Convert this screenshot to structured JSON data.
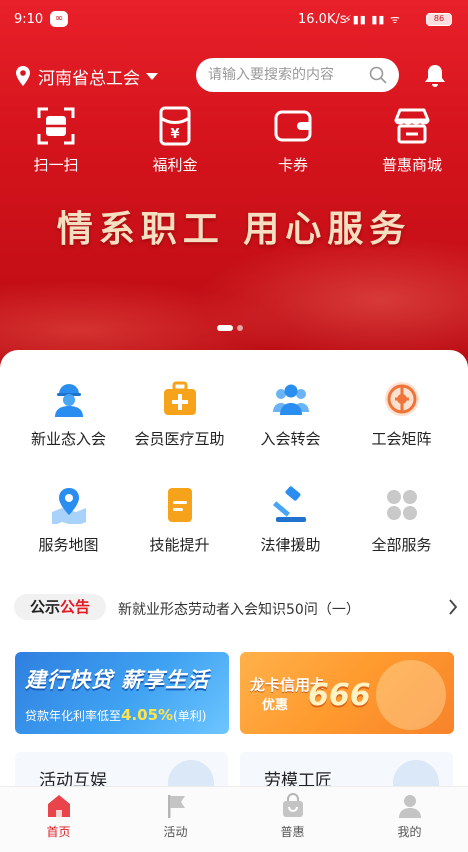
{
  "status_bar": {
    "time": "9:10",
    "network_speed": "16.0K/s",
    "battery": "86"
  },
  "header": {
    "location": "河南省总工会",
    "search_placeholder": "请输入要搜索的内容"
  },
  "quick_actions": [
    {
      "label": "扫一扫",
      "icon": "scan-icon"
    },
    {
      "label": "福利金",
      "icon": "red-envelope-icon"
    },
    {
      "label": "卡券",
      "icon": "wallet-icon"
    },
    {
      "label": "普惠商城",
      "icon": "store-icon"
    }
  ],
  "banner": {
    "text": "情系职工 用心服务"
  },
  "services": [
    {
      "label": "新业态入会",
      "icon": "worker-icon"
    },
    {
      "label": "会员医疗互助",
      "icon": "medical-kit-icon"
    },
    {
      "label": "入会转会",
      "icon": "people-group-icon"
    },
    {
      "label": "工会矩阵",
      "icon": "union-emblem-icon"
    },
    {
      "label": "服务地图",
      "icon": "map-pin-icon"
    },
    {
      "label": "技能提升",
      "icon": "document-icon"
    },
    {
      "label": "法律援助",
      "icon": "gavel-icon"
    },
    {
      "label": "全部服务",
      "icon": "grid-icon"
    }
  ],
  "notice": {
    "tag_part1": "公示",
    "tag_part2": "公告",
    "text": "新就业形态劳动者入会知识50问（一）"
  },
  "promos": [
    {
      "title": "建行快贷 薪享生活",
      "subtitle": "贷款年化利率低至",
      "rate": "4.05%",
      "suffix": "(单利)"
    },
    {
      "title": "龙卡信用卡",
      "subtitle": "优惠",
      "number": "666"
    }
  ],
  "tiles": [
    {
      "label": "活动互娱"
    },
    {
      "label": "劳模工匠"
    }
  ],
  "tabs": [
    {
      "label": "首页",
      "icon": "home-icon",
      "active": true
    },
    {
      "label": "活动",
      "icon": "flag-icon",
      "active": false
    },
    {
      "label": "普惠",
      "icon": "shopping-bag-icon",
      "active": false
    },
    {
      "label": "我的",
      "icon": "user-icon",
      "active": false
    }
  ],
  "colors": {
    "brand_red": "#e21b23",
    "banner_text": "#f6dfc0",
    "service_blue": "#2a8df0",
    "service_orange": "#f7a21b"
  }
}
